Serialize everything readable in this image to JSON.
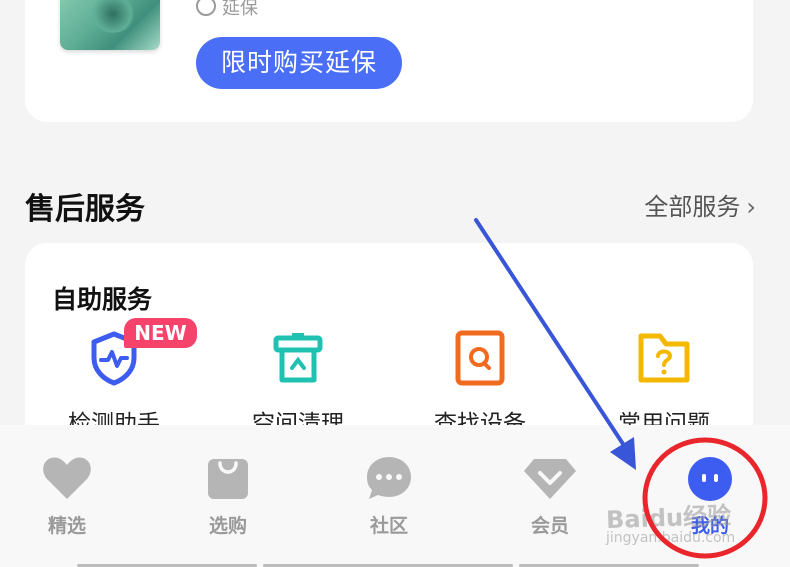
{
  "product": {
    "warranty_label": "延保",
    "buy_button": "限时购买延保"
  },
  "after_sales": {
    "title": "售后服务",
    "all_services": "全部服务"
  },
  "self_service": {
    "title": "自助服务",
    "badge": "NEW",
    "items": [
      {
        "label": "检测助手",
        "icon": "shield-pulse-icon"
      },
      {
        "label": "空间清理",
        "icon": "trash-can-icon"
      },
      {
        "label": "查找设备",
        "icon": "find-device-icon"
      },
      {
        "label": "常用问题",
        "icon": "question-folder-icon"
      }
    ]
  },
  "tabbar": {
    "tabs": [
      {
        "label": "精选",
        "icon": "heart-icon"
      },
      {
        "label": "选购",
        "icon": "shopping-bag-icon"
      },
      {
        "label": "社区",
        "icon": "chat-bubble-icon"
      },
      {
        "label": "会员",
        "icon": "diamond-icon"
      },
      {
        "label": "我的",
        "icon": "face-icon"
      }
    ],
    "active": "我的"
  },
  "annotations": {
    "watermark": "Baidu经验",
    "watermark_sub": "jingyan.baidu.com"
  },
  "colors": {
    "accent": "#4a6ef5",
    "tab_active": "#3d5cf0",
    "badge": "#f5436b",
    "annotation": "#e8262b",
    "arrow": "#3a56d8",
    "icon_blue": "#3d5cf0",
    "icon_teal": "#1fc2b0",
    "icon_orange": "#f06a1f",
    "icon_yellow": "#f5b800",
    "tab_inactive": "#9a9a9a"
  }
}
